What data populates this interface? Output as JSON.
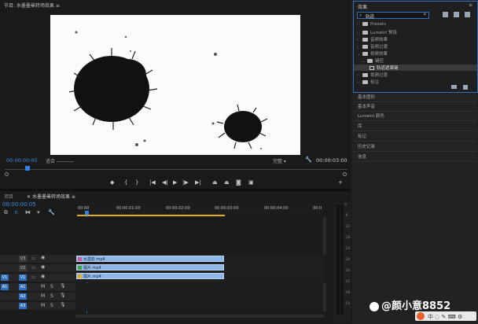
{
  "sequence_title": "节目: 水墨墨晕转场效果 ≡",
  "monitor": {
    "current_time": "00:00:00:05",
    "fit_label": "适合",
    "quality_label": "完整",
    "duration": "00:00:03:00"
  },
  "effects_panel": {
    "title": "效果",
    "menu_glyph": "≡",
    "search_value": "轨道",
    "tree": [
      {
        "label": "Presets",
        "indent": 0,
        "expanded": false
      },
      {
        "label": "Lumetri 预设",
        "indent": 0,
        "expanded": false
      },
      {
        "label": "音频效果",
        "indent": 0,
        "expanded": false
      },
      {
        "label": "音频过渡",
        "indent": 0,
        "expanded": false
      },
      {
        "label": "视频效果",
        "indent": 0,
        "expanded": true
      },
      {
        "label": "键控",
        "indent": 1,
        "expanded": true
      },
      {
        "label": "轨道遮罩键",
        "indent": 2,
        "selected": true
      },
      {
        "label": "视频过渡",
        "indent": 0,
        "expanded": false
      },
      {
        "label": "标注",
        "indent": 0,
        "expanded": false
      }
    ]
  },
  "panels": [
    "基本图形",
    "基本声音",
    "Lumetri 颜色",
    "库",
    "标记",
    "历史记录",
    "信息"
  ],
  "timeline": {
    "tab_project": "项目",
    "tab_sequence": "水墨墨晕转场效果",
    "timecode": "00:00:00:05",
    "ruler": [
      "00:00",
      "00:00:01:00",
      "00:00:02:00",
      "00:00:03:00",
      "00:00:04:00",
      "00:0"
    ],
    "video_tracks": [
      "V3",
      "V2",
      "V1"
    ],
    "audio_tracks": [
      "A1",
      "A2",
      "A3"
    ],
    "clips": [
      {
        "name": "水墨影.mp4",
        "track": "V3"
      },
      {
        "name": "图片.mp4",
        "track": "V2"
      },
      {
        "name": "图片.mp4",
        "track": "V1"
      }
    ],
    "meter_ticks": [
      "0",
      "-6",
      "-12",
      "-18",
      "-24",
      "-30",
      "-36",
      "-42",
      "-48",
      "-54"
    ]
  },
  "watermark": "@颜小意8852"
}
